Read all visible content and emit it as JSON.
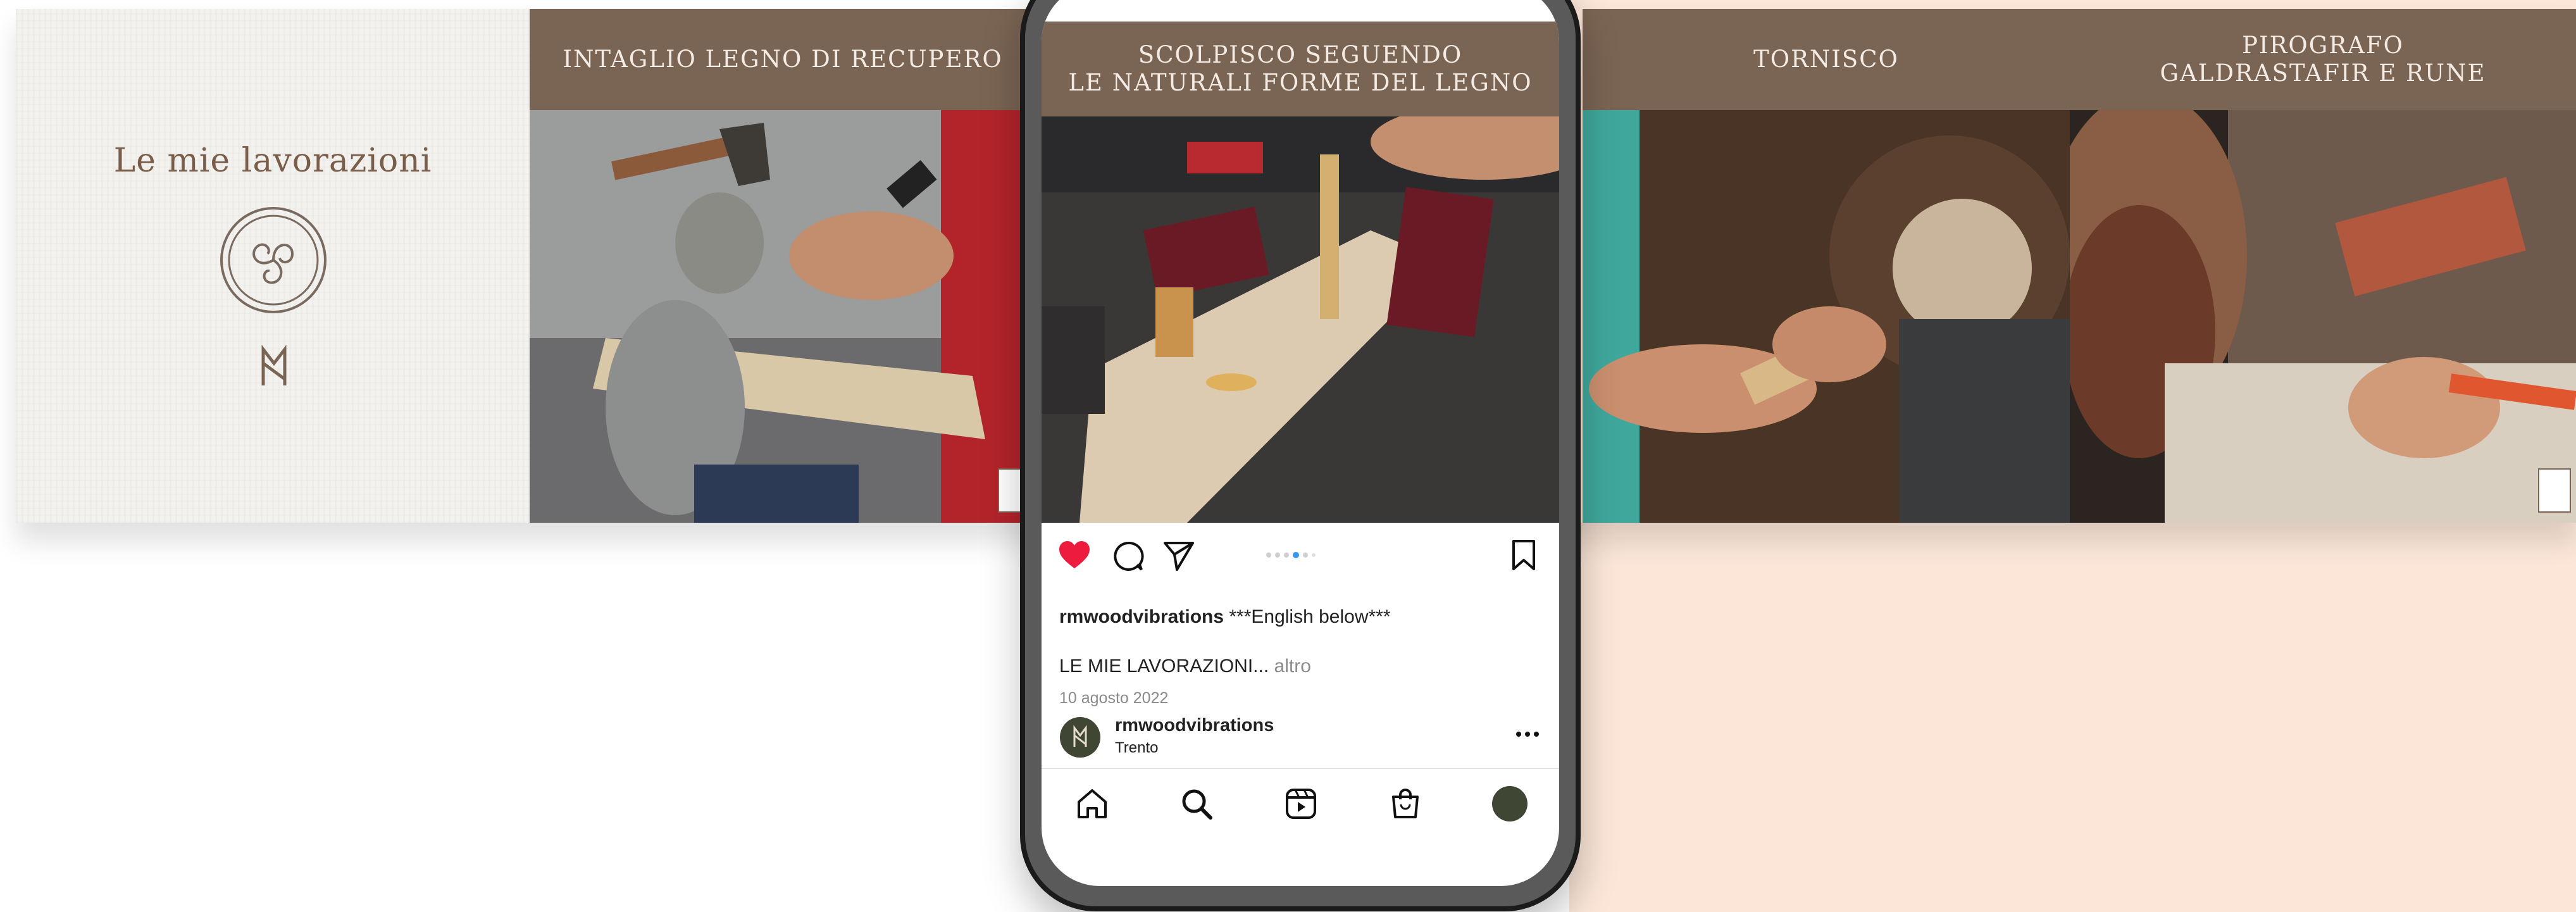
{
  "colors": {
    "banner_brown": "#7a6453",
    "intro_text": "#7a5e4a",
    "right_background": "#fbe6d8",
    "like_red": "#ed1c3f",
    "dot_active": "#3897f0"
  },
  "carousel": {
    "intro": {
      "title": "Le mie lavorazioni",
      "emblem_icon": "triskelion-emblem-icon",
      "monogram_icon": "rm-rune-monogram-icon"
    },
    "cards": [
      {
        "title_lines": [
          "INTAGLIO LEGNO DI RECUPERO"
        ],
        "photo": "carving reclaimed wood with axe and knife"
      },
      {
        "title_lines": [
          "TORNISCO"
        ],
        "photo": "wood turning on lathe"
      },
      {
        "title_lines": [
          "PIROGRAFO",
          "GALDRASTAFIR E RUNE"
        ],
        "photo": "pyrography of runes"
      }
    ]
  },
  "phone": {
    "post": {
      "title_lines": [
        "SCOLPISCO SEGUENDO",
        "LE NATURALI FORME DEL LEGNO"
      ],
      "photo": "sculpting wood following natural shapes"
    },
    "actions": {
      "like_icon": "heart-icon",
      "comment_icon": "comment-icon",
      "share_icon": "send-icon",
      "save_icon": "bookmark-icon",
      "carousel_pages": 6,
      "carousel_active_page": 4
    },
    "caption": {
      "username": "rmwoodvibrations",
      "text": " ***English below***",
      "preview": "LE MIE LAVORAZIONI...",
      "more": " altro",
      "date": "10 agosto 2022"
    },
    "author": {
      "username": "rmwoodvibrations",
      "location": "Trento",
      "avatar_icon": "rm-avatar-icon",
      "menu_icon": "more-dots-icon"
    },
    "nav": [
      "home-icon",
      "search-icon",
      "reels-icon",
      "shop-icon",
      "profile-avatar-icon"
    ]
  }
}
